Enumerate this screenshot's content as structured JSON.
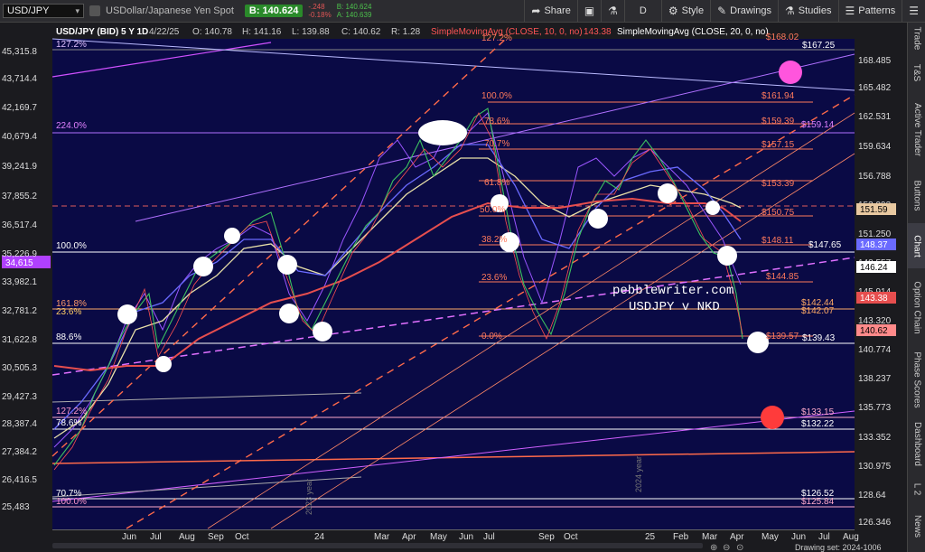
{
  "toolbar": {
    "symbol": "USD/JPY",
    "instrument_name": "USDollar/Japanese Yen Spot",
    "bid_label": "B: 140.624",
    "change_abs": "-.248",
    "change_pct": "-0.18%",
    "bid_small": "B: 140.624",
    "ask_small": "A: 140.639",
    "buttons": {
      "share": "Share",
      "aggregation": "D",
      "style": "Style",
      "drawings": "Drawings",
      "studies": "Studies",
      "patterns": "Patterns"
    }
  },
  "chart_header": {
    "title": "USD/JPY (BID) 5 Y 1D",
    "date": "4/22/25",
    "open": "O: 140.78",
    "high": "H: 141.16",
    "low": "L: 139.88",
    "close": "C: 140.62",
    "range": "R: 1.28",
    "sma10": "SimpleMovingAvg (CLOSE, 10, 0, no)",
    "sma10_val": "143.38",
    "sma20": "SimpleMovingAvg (CLOSE, 20, 0, no)"
  },
  "watermark": {
    "line1": "pebblewriter.com",
    "line2": "USDJPY v NKD"
  },
  "y_axis_right": [
    "168.485",
    "165.482",
    "162.531",
    "159.634",
    "156.788",
    "153.993",
    "151.250",
    "148.557",
    "145.914",
    "143.320",
    "140.774",
    "138.237",
    "135.773",
    "133.352",
    "130.975",
    "128.64",
    "126.346"
  ],
  "y_axis_left": [
    "45,315.8",
    "43,714.4",
    "42,169.7",
    "40,679.4",
    "39,241.9",
    "37,855.2",
    "36,517.4",
    "35,226.9",
    "33,982.1",
    "32,781.2",
    "31,622.8",
    "30,505.3",
    "29,427.3",
    "28,387.4",
    "27,384.2",
    "26,416.5",
    "25,483"
  ],
  "x_axis": [
    "Jun",
    "Jul",
    "Aug",
    "Sep",
    "Oct",
    "24",
    "Mar",
    "Apr",
    "May",
    "Jun",
    "Jul",
    "Sep",
    "Oct",
    "25",
    "Feb",
    "Mar",
    "Apr",
    "May",
    "Jun",
    "Jul",
    "Aug"
  ],
  "year_labels": [
    "2023 year",
    "2024 year"
  ],
  "price_tags": {
    "left_nkd": "34,615",
    "p151": "151.59",
    "p148": "148.37",
    "p146": "146.24",
    "p143": "143.38",
    "p140": "140.62"
  },
  "fib_left": {
    "f127": "127.2%",
    "f224": "224.0%",
    "f100": "100.0%",
    "f1618": "161.8%",
    "f236": "23.6%",
    "f886": "88.6%",
    "f127b": "127.2%",
    "f786": "78.6%",
    "f707": "70.7%",
    "f100b": "100.0%"
  },
  "fib_mid": {
    "f1272": "127.2%",
    "f100": "100.0%",
    "f786": "78.6%",
    "f70": "70.7%",
    "f618": "61.8%",
    "f50": "50.0%",
    "f382": "38.2%",
    "f236": "23.6%",
    "f0": "0.0%"
  },
  "target_labels": {
    "t168": "$168.02",
    "t167": "$167.25",
    "t161": "$161.94",
    "t159a": "$159.39",
    "t159b": "$159.14",
    "t157": "$157.15",
    "t153": "$153.39",
    "t150": "$150.75",
    "t148": "$148.11",
    "t147": "$147.65",
    "t144": "$144.85",
    "t142a": "$142.44",
    "t142b": "$142.07",
    "t139a": "$139.57",
    "t139b": "$139.43",
    "t133": "$133.15",
    "t132": "$132.22",
    "t126": "$126.52",
    "t125": "$125.84"
  },
  "footer": {
    "drawing_set": "Drawing set: 2024-1006"
  },
  "side_tabs": [
    "Trade",
    "T&S",
    "Active Trader",
    "Buttons",
    "Chart",
    "Option Chain",
    "Phase Scores",
    "Dashboard",
    "L 2",
    "News"
  ],
  "colors": {
    "chart_bg": "#0a0a45",
    "fib_line": "#ff7a5c",
    "trend_pink": "#e060ff",
    "sma_red": "#e64e4e",
    "sma_blue": "#6a6aff",
    "sma_cream": "#e8e0a8",
    "nkd_purple": "#9a55ff",
    "magenta_dot": "#ff55dd",
    "red_dot": "#ff3b3b"
  }
}
